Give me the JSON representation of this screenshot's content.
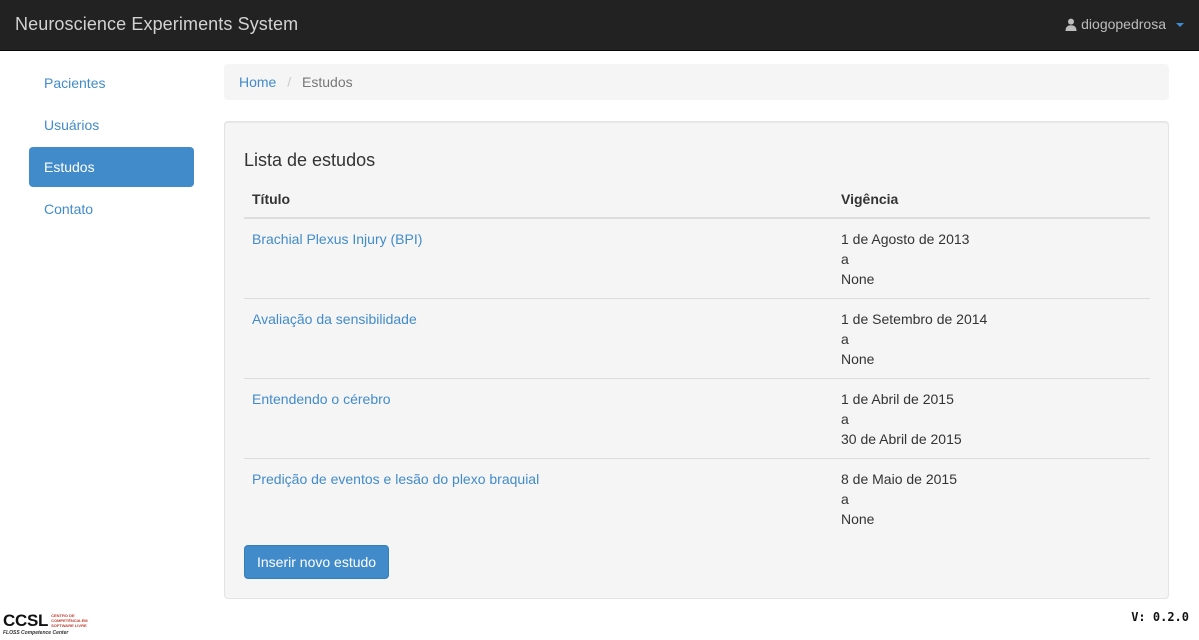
{
  "navbar": {
    "brand": "Neuroscience Experiments System",
    "user": "diogopedrosa",
    "user_icon": "user-icon",
    "accent": "#428bca"
  },
  "sidebar": {
    "items": [
      {
        "label": "Pacientes",
        "active": false
      },
      {
        "label": "Usuários",
        "active": false
      },
      {
        "label": "Estudos",
        "active": true
      },
      {
        "label": "Contato",
        "active": false
      }
    ]
  },
  "breadcrumb": {
    "home": "Home",
    "separator": "/",
    "current": "Estudos"
  },
  "main": {
    "heading": "Lista de estudos",
    "columns": [
      "Título",
      "Vigência"
    ],
    "rows": [
      {
        "title": "Brachial Plexus Injury (BPI)",
        "start": "1 de Agosto de 2013",
        "connector": "a",
        "end": "None"
      },
      {
        "title": "Avaliação da sensibilidade",
        "start": "1 de Setembro de 2014",
        "connector": "a",
        "end": "None"
      },
      {
        "title": "Entendendo o cérebro",
        "start": "1 de Abril de 2015",
        "connector": "a",
        "end": "30 de Abril de 2015"
      },
      {
        "title": "Predição de eventos e lesão do plexo braquial",
        "start": "8 de Maio de 2015",
        "connector": "a",
        "end": "None"
      }
    ],
    "add_button": "Inserir novo estudo"
  },
  "footer": {
    "logo": "CCSL",
    "logo_subtitle": "CENTRO DE COMPETÊNCIA EM SOFTWARE LIVRE",
    "logo_tagline": "FLOSS Competence Center",
    "version": "V: 0.2.0"
  }
}
